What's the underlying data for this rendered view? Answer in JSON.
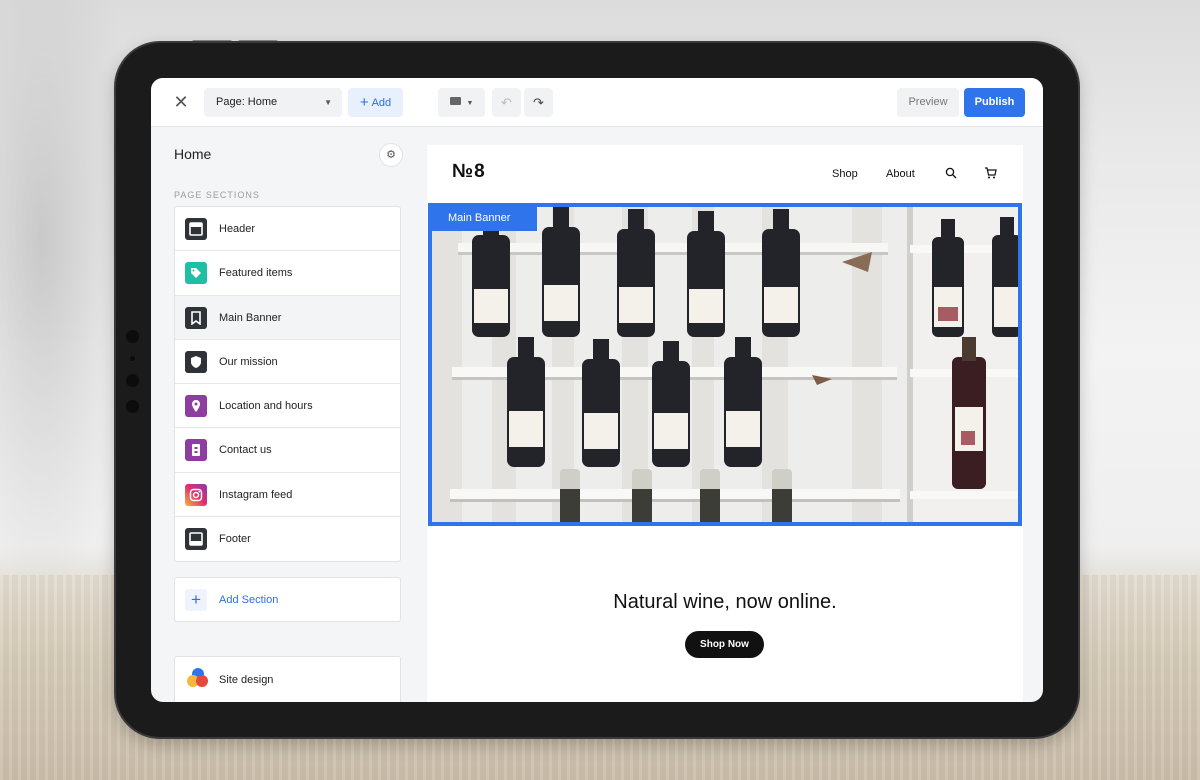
{
  "toolbar": {
    "page_select": "Page: Home",
    "add_label": "Add",
    "preview_label": "Preview",
    "publish_label": "Publish"
  },
  "sidebar": {
    "title": "Home",
    "sections_label": "PAGE SECTIONS",
    "items": [
      {
        "label": "Header",
        "icon": "header-icon"
      },
      {
        "label": "Featured items",
        "icon": "tag-icon"
      },
      {
        "label": "Main Banner",
        "icon": "bookmark-icon",
        "active": true
      },
      {
        "label": "Our mission",
        "icon": "shield-icon"
      },
      {
        "label": "Location and hours",
        "icon": "location-pin-icon"
      },
      {
        "label": "Contact us",
        "icon": "contact-card-icon"
      },
      {
        "label": "Instagram feed",
        "icon": "instagram-icon"
      },
      {
        "label": "Footer",
        "icon": "footer-icon"
      }
    ],
    "add_section_label": "Add Section",
    "site_design_label": "Site design"
  },
  "site": {
    "logo": "№8",
    "nav": {
      "shop": "Shop",
      "about": "About"
    },
    "banner_tag": "Main Banner",
    "headline": "Natural wine, now online.",
    "cta": "Shop Now"
  },
  "colors": {
    "accent": "#2f74ea",
    "teal_icon": "#1fbfa6",
    "purple_icon": "#8e3ea1",
    "dark_icon": "#2f3338"
  }
}
